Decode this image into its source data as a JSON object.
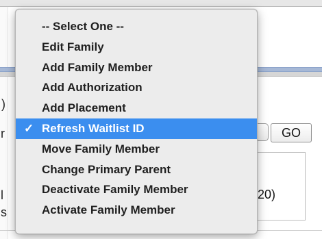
{
  "background": {
    "fragment_paren": ")",
    "fragment_r": "r",
    "fragment_l": "l",
    "fragment_s": "s",
    "count_fragment": "20)",
    "go_label": "GO"
  },
  "dropdown": {
    "check_glyph": "✓",
    "selected_index": 5,
    "colors": {
      "highlight": "#3b8eef",
      "menu_bg": "#ececec",
      "text": "#1f1f1f"
    },
    "options": [
      "-- Select One --",
      "Edit Family",
      "Add Family Member",
      "Add Authorization",
      "Add Placement",
      "Refresh Waitlist ID",
      "Move Family Member",
      "Change Primary Parent",
      "Deactivate Family Member",
      "Activate Family Member"
    ]
  }
}
